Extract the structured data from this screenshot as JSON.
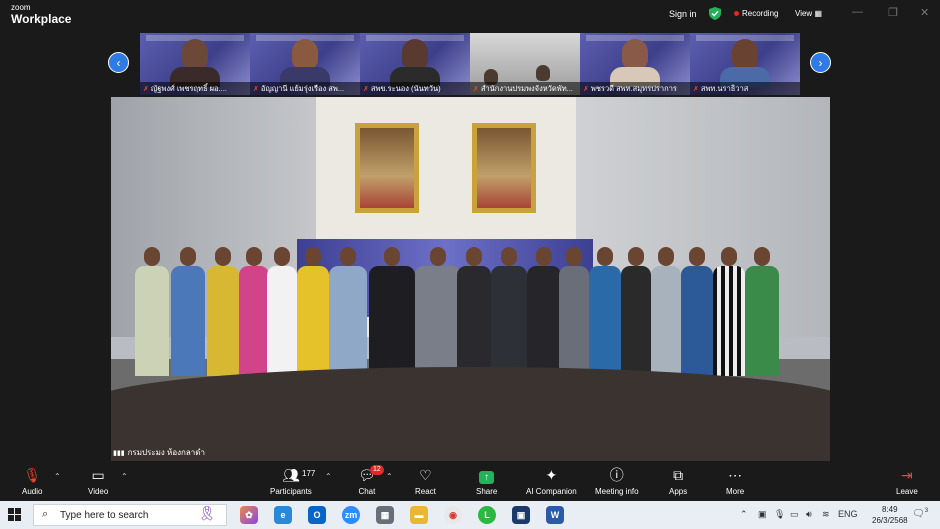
{
  "app": {
    "logo_top": "zoom",
    "logo_bottom": "Workplace"
  },
  "topbar": {
    "signin": "Sign in",
    "recording": "Recording",
    "view": "View"
  },
  "participants_strip": [
    {
      "name": "ญัฐพงศ์ เพชรฤทธิ์ ผอ...."
    },
    {
      "name": "อัญญานี แย้มรุ่งเรือง สพ..."
    },
    {
      "name": "สพข.ระนอง (นันทวัน)"
    },
    {
      "name": "สำนักงานปรมพงจังหวัดพัท..."
    },
    {
      "name": "พชรวดี สพท.สมุทรปราการ"
    },
    {
      "name": "สพท.นราธิวาส"
    }
  ],
  "main_video": {
    "label": "กรมประมง ห้องกลาดำ"
  },
  "toolbar": {
    "audio": "Audio",
    "video": "Video",
    "participants": "Participants",
    "participants_count": "177",
    "chat": "Chat",
    "chat_badge": "12",
    "react": "React",
    "share": "Share",
    "ai_companion": "AI Companion",
    "meeting_info": "Meeting info",
    "apps": "Apps",
    "more": "More",
    "leave": "Leave"
  },
  "taskbar": {
    "search_placeholder": "Type here to search",
    "lang": "ENG",
    "time": "8:49",
    "date": "26/3/2568",
    "notif_count": "3"
  },
  "colors": {
    "accent": "#2e7be6",
    "recording": "#e02828",
    "share": "#22b35a"
  }
}
